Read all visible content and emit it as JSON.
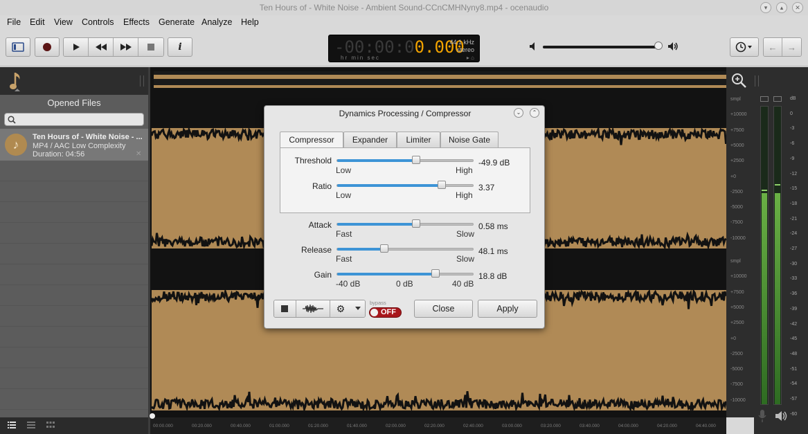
{
  "window": {
    "title": "Ten Hours of  - White Noise - Ambient Sound-CCnCMHNyny8.mp4 - ocenaudio",
    "controls": [
      "minimize",
      "maximize",
      "close"
    ]
  },
  "menu": [
    "File",
    "Edit",
    "View",
    "Controls",
    "Effects",
    "Generate",
    "Analyze",
    "Help"
  ],
  "toolbar": {
    "buttons": [
      "sidebar-toggle",
      "record",
      "play",
      "rewind",
      "fast-forward",
      "stop",
      "info"
    ],
    "info_label": "i"
  },
  "lcd": {
    "time_dim": "-00:00:0",
    "time_lit": "0.000",
    "units": "hr   min  sec",
    "rate": "44.1 kHz",
    "channels": "stereo",
    "status": "▸ ⌂"
  },
  "volume": {
    "level": 0.97
  },
  "sidebar": {
    "opened_files_title": "Opened Files",
    "search_placeholder": "",
    "file": {
      "name": "Ten Hours of  - White Noise - ...",
      "format": "MP4 / AAC Low Complexity",
      "duration": "Duration: 04:56"
    }
  },
  "waveform": {
    "sample_scale_top": [
      "smpl",
      "+10000",
      "+7500",
      "+5000",
      "+2500",
      "+0",
      "-2500",
      "-5000",
      "-7500",
      "-10000"
    ],
    "sample_scale_bottom": [
      "smpl",
      "+10000",
      "+7500",
      "+5000",
      "+2500",
      "+0",
      "-2500",
      "-5000",
      "-7500",
      "-10000"
    ],
    "time_labels": [
      "00:00.000",
      "00:20.000",
      "00:40.000",
      "01:00.000",
      "01:20.000",
      "01:40.000",
      "02:00.000",
      "02:20.000",
      "02:40.000",
      "03:00.000",
      "03:20.000",
      "03:40.000",
      "04:00.000",
      "04:20.000",
      "04:40.000"
    ]
  },
  "meters": {
    "scale": [
      "dB",
      "0",
      "-3",
      "-6",
      "-9",
      "-12",
      "-15",
      "-18",
      "-21",
      "-24",
      "-27",
      "-30",
      "-33",
      "-36",
      "-39",
      "-42",
      "-45",
      "-48",
      "-51",
      "-54",
      "-57",
      "-60"
    ]
  },
  "dialog": {
    "title": "Dynamics Processing / Compressor",
    "tabs": [
      "Compressor",
      "Expander",
      "Limiter",
      "Noise Gate"
    ],
    "active_tab": "Compressor",
    "threshold": {
      "label": "Threshold",
      "low": "Low",
      "high": "High",
      "value": "-49.9 dB",
      "position": 0.58
    },
    "ratio": {
      "label": "Ratio",
      "low": "Low",
      "high": "High",
      "value": "3.37",
      "position": 0.77
    },
    "attack": {
      "label": "Attack",
      "low": "Fast",
      "high": "Slow",
      "value": "0.58 ms",
      "position": 0.58
    },
    "release": {
      "label": "Release",
      "low": "Fast",
      "high": "Slow",
      "value": "48.1 ms",
      "position": 0.35
    },
    "gain": {
      "label": "Gain",
      "low": "-40 dB",
      "mid": "0 dB",
      "high": "40 dB",
      "value": "18.8 dB",
      "position": 0.72
    },
    "bypass_label": "bypass",
    "bypass_state": "OFF",
    "close_label": "Close",
    "apply_label": "Apply"
  },
  "colors": {
    "waveform": "#b08a56",
    "accent": "#3d94d6",
    "lcd_lit": "#f2a300",
    "bypass": "#a8171c"
  }
}
